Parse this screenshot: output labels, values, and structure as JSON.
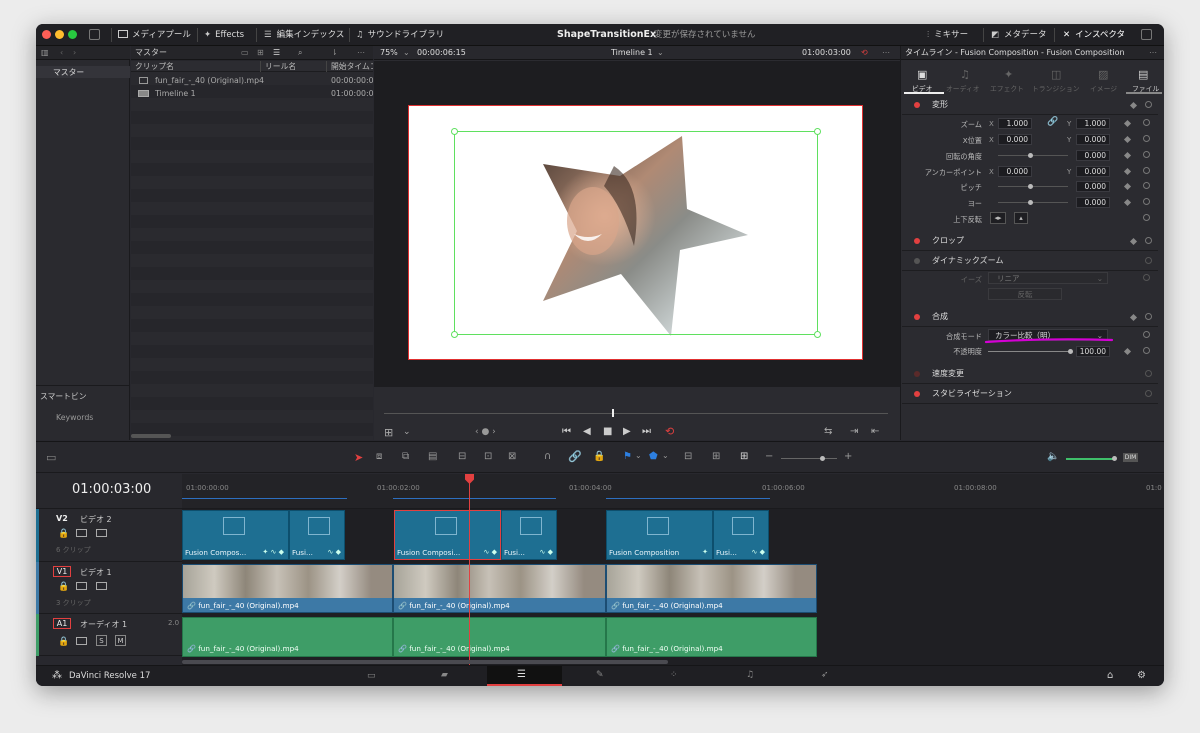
{
  "app": {
    "project_title": "ShapeTransitionEx",
    "save_status": "変更が保存されていません",
    "version_label": "DaVinci Resolve 17"
  },
  "topbar": {
    "media_pool": "メディアプール",
    "effects": "Effects",
    "edit_index": "編集インデックス",
    "sound_library": "サウンドライブラリ",
    "mixer": "ミキサー",
    "metadata": "メタデータ",
    "inspector": "インスペクタ"
  },
  "media_pool": {
    "bin_title": "マスター",
    "bins": [
      "マスター"
    ],
    "columns": [
      "クリップ名",
      "リール名",
      "開始タイムコード"
    ],
    "clips": [
      {
        "name": "fun_fair_-_40 (Original).mp4",
        "start": "00:00:00:00"
      },
      {
        "name": "Timeline 1",
        "start": "01:00:00:00"
      }
    ],
    "smart_bins_title": "スマートビン",
    "smart_bins": [
      "Keywords"
    ]
  },
  "viewer": {
    "zoom": "75%",
    "timecode_left": "00:00:06:15",
    "timeline_name": "Timeline 1",
    "timecode_right": "01:00:03:00"
  },
  "inspector": {
    "header": "タイムライン - Fusion Composition - Fusion Composition",
    "tabs": [
      "ビデオ",
      "オーディオ",
      "エフェクト",
      "トランジション",
      "イメージ",
      "ファイル"
    ],
    "transform": {
      "title": "変形",
      "zoom_label": "ズーム",
      "zoom_x": "1.000",
      "zoom_y": "1.000",
      "position_label": "X位置",
      "position_x": "0.000",
      "position_y": "0.000",
      "rotation_label": "回転の角度",
      "rotation": "0.000",
      "anchor_label": "アンカーポイント",
      "anchor_x": "0.000",
      "anchor_y": "0.000",
      "pitch_label": "ピッチ",
      "pitch": "0.000",
      "yaw_label": "ヨー",
      "yaw": "0.000",
      "flip_label": "上下反転"
    },
    "crop_title": "クロップ",
    "dynamic_zoom": {
      "title": "ダイナミックズーム",
      "ease_label": "イーズ",
      "ease_value": "リニア",
      "swap_button": "反転"
    },
    "composite": {
      "title": "合成",
      "mode_label": "合成モード",
      "mode_value": "カラー比較（明）",
      "opacity_label": "不透明度",
      "opacity_value": "100.00"
    },
    "speed_title": "速度変更",
    "stabilization_title": "スタビライゼーション"
  },
  "timeline": {
    "timecode": "01:00:03:00",
    "ruler": [
      "01:00:00:00",
      "01:00:02:00",
      "01:00:04:00",
      "01:00:06:00",
      "01:00:08:00",
      "01:0"
    ],
    "tracks": {
      "v2": {
        "id": "V2",
        "name": "ビデオ 2",
        "count": "6 クリップ"
      },
      "v1": {
        "id": "V1",
        "name": "ビデオ 1",
        "count": "3 クリップ"
      },
      "a1": {
        "id": "A1",
        "name": "オーディオ 1",
        "channels": "2.0",
        "solo": "S",
        "mute": "M"
      }
    },
    "v2_clips": [
      {
        "label": "Fusion Compos..."
      },
      {
        "label": "Fusi..."
      },
      {
        "label": "Fusion Composi..."
      },
      {
        "label": "Fusi..."
      },
      {
        "label": "Fusion Composition"
      },
      {
        "label": "Fusi..."
      }
    ],
    "v1_clips": [
      {
        "label": "fun_fair_-_40 (Original).mp4"
      },
      {
        "label": "fun_fair_-_40 (Original).mp4"
      },
      {
        "label": "fun_fair_-_40 (Original).mp4"
      }
    ],
    "a1_clips": [
      {
        "label": "fun_fair_-_40 (Original).mp4"
      },
      {
        "label": "fun_fair_-_40 (Original).mp4"
      },
      {
        "label": "fun_fair_-_40 (Original).mp4"
      }
    ],
    "dim_label": "DIM"
  },
  "colors": {
    "accent_red": "#e24040",
    "v2_clip": "#1e6f92",
    "v1_clip": "#3d79a6",
    "audio_clip": "#3e9d67",
    "highlight_magenta": "#d400d4"
  }
}
